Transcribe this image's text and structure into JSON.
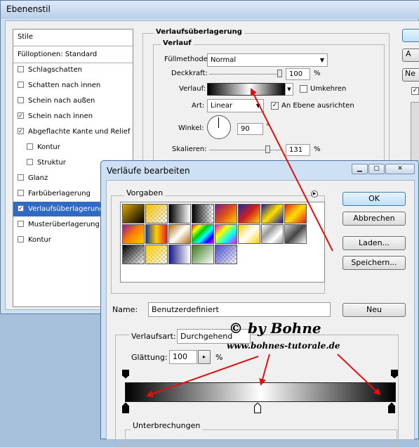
{
  "ebenenstil": {
    "title": "Ebenenstil",
    "styles": [
      {
        "label": "Stile",
        "checkbox": false
      },
      {
        "label": "Fülloptionen: Standard",
        "checkbox": false
      },
      {
        "label": "Schlagschatten",
        "checkbox": true,
        "checked": false
      },
      {
        "label": "Schatten nach innen",
        "checkbox": true,
        "checked": false
      },
      {
        "label": "Schein nach außen",
        "checkbox": true,
        "checked": false
      },
      {
        "label": "Schein nach innen",
        "checkbox": true,
        "checked": true
      },
      {
        "label": "Abgeflachte Kante und Relief",
        "checkbox": true,
        "checked": true
      },
      {
        "label": "Kontur",
        "checkbox": true,
        "checked": false,
        "indent": true
      },
      {
        "label": "Struktur",
        "checkbox": true,
        "checked": false,
        "indent": true
      },
      {
        "label": "Glanz",
        "checkbox": true,
        "checked": false
      },
      {
        "label": "Farbüberlagerung",
        "checkbox": true,
        "checked": false
      },
      {
        "label": "Verlaufsüberlagerung",
        "checkbox": true,
        "checked": true,
        "selected": true
      },
      {
        "label": "Musterüberlagerung",
        "checkbox": true,
        "checked": false
      },
      {
        "label": "Kontur",
        "checkbox": true,
        "checked": false
      }
    ],
    "section_title": "Verlaufsüberlagerung",
    "group_title": "Verlauf",
    "fuellmethode_label": "Füllmethode:",
    "fuellmethode_value": "Normal",
    "deckkraft_label": "Deckkraft:",
    "deckkraft_value": "100",
    "deckkraft_unit": "%",
    "deckkraft_level": 100,
    "verlauf_label": "Verlauf:",
    "umkehren_label": "Umkehren",
    "umkehren_checked": false,
    "art_label": "Art:",
    "art_value": "Linear",
    "an_ebene_label": "An Ebene ausrichten",
    "an_ebene_checked": true,
    "winkel_label": "Winkel:",
    "winkel_value": "90",
    "winkel_unit": "°",
    "skalieren_label": "Skalieren:",
    "skalieren_value": "131",
    "skalieren_unit": "%",
    "skalieren_level": 131,
    "right_buttons": [
      "",
      "A",
      "Ne"
    ],
    "right_checkbox_checked": true
  },
  "verlaeufe": {
    "title": "Verläufe bearbeiten",
    "window_buttons": [
      "minimize-icon",
      "maximize-icon",
      "close-icon"
    ],
    "vorgaben_label": "Vorgaben",
    "presets": [
      "linear-gradient(135deg,#d9a400,#000)",
      "linear-gradient(135deg,#f7c000,rgba(255,255,255,0))",
      "linear-gradient(90deg,#000,#fff)",
      "linear-gradient(90deg,#000,rgba(255,255,255,0))",
      "linear-gradient(135deg,#7a1a8a,#e0501a,#ffd000)",
      "linear-gradient(135deg,#1a2aa0,#d02020,#ffd000)",
      "linear-gradient(135deg,#1a1a9a,#ffe000,#1a1a9a)",
      "linear-gradient(135deg,#e02020,#ffe000,#e02020)",
      "linear-gradient(135deg,#8a1a9a,#ff8000,#ffd000)",
      "linear-gradient(90deg,#1a3aa0,#ffd000,#e02020)",
      "linear-gradient(135deg,#b0700a,#fff,#b0700a)",
      "linear-gradient(135deg,#e02020,#ff0,#0c0,#0ff,#00f,#f0f)",
      "linear-gradient(135deg,#ff00ff,#ff0,#0ff,#ff00ff)",
      "linear-gradient(135deg,#ffd000,#fff,#ffd000)",
      "linear-gradient(135deg,#fff,#999,#fff,#999)",
      "linear-gradient(135deg,#ccc,#444,#fff)",
      "linear-gradient(135deg,#000,rgba(255,255,255,0))",
      "linear-gradient(135deg,#ffd000,rgba(255,255,255,0))",
      "linear-gradient(90deg,#1a1a8a,#fff)",
      "linear-gradient(135deg,#3a7a1a,#fff)",
      "linear-gradient(135deg,#4a4ad0,rgba(255,255,255,0))"
    ],
    "name_label": "Name:",
    "name_value": "Benutzerdefiniert",
    "buttons": {
      "ok": "OK",
      "abbrechen": "Abbrechen",
      "laden": "Laden...",
      "speichern": "Speichern...",
      "neu": "Neu"
    },
    "verlaufsart_label": "Verlaufsart:",
    "verlaufsart_value": "Durchgehend",
    "glaettung_label": "Glättung:",
    "glaettung_value": "100",
    "glaettung_unit": "%",
    "unterbrechungen_label": "Unterbrechungen"
  },
  "watermark": {
    "line1": "© by Bohne",
    "line2": "www.bohnes-tutorale.de"
  },
  "colors": {
    "selection": "#316ac5",
    "arrow": "#e01010",
    "titlebar": "#cde0f4"
  }
}
